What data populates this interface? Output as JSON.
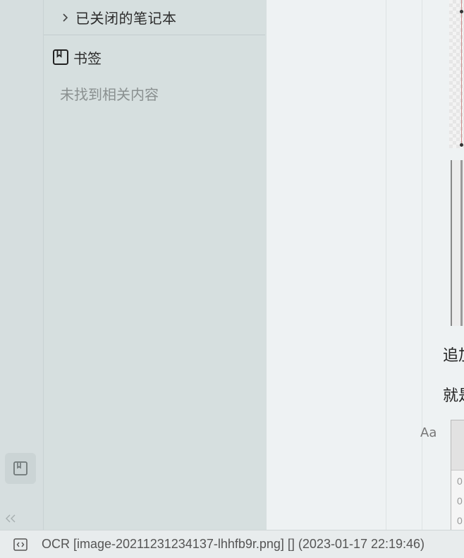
{
  "sidebar": {
    "closed_notebooks_label": "已关闭的笔记本",
    "bookmarks_label": "书签",
    "empty_message": "未找到相关内容"
  },
  "editor": {
    "line1": "追加",
    "line2": "就是",
    "font_button": "Aa",
    "table_cells": [
      "0",
      "0",
      "0"
    ]
  },
  "statusbar": {
    "text": "OCR [image-20211231234137-lhhfb9r.png] [] (2023-01-17 22:19:46)"
  }
}
